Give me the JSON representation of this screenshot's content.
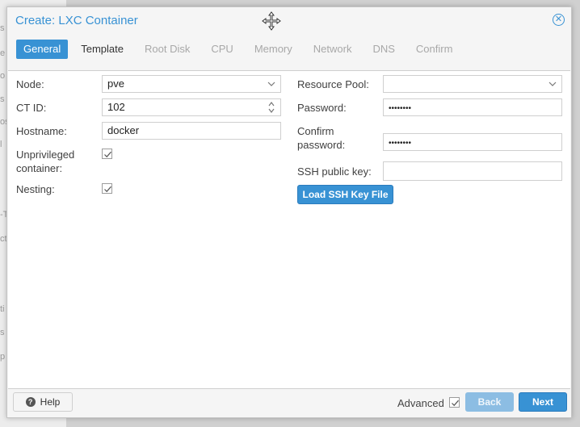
{
  "background": {
    "fragments": [
      "s",
      "e",
      "o",
      "s",
      "os",
      "l",
      "-T",
      "ct",
      "ti",
      "s",
      "p"
    ]
  },
  "dialog": {
    "title": "Create: LXC Container",
    "tabs": [
      {
        "label": "General",
        "state": "active"
      },
      {
        "label": "Template",
        "state": "enabled"
      },
      {
        "label": "Root Disk",
        "state": "disabled"
      },
      {
        "label": "CPU",
        "state": "disabled"
      },
      {
        "label": "Memory",
        "state": "disabled"
      },
      {
        "label": "Network",
        "state": "disabled"
      },
      {
        "label": "DNS",
        "state": "disabled"
      },
      {
        "label": "Confirm",
        "state": "disabled"
      }
    ],
    "accent_color": "#3892d4"
  },
  "form": {
    "node": {
      "label": "Node:",
      "value": "pve"
    },
    "ctid": {
      "label": "CT ID:",
      "value": "102"
    },
    "hostname": {
      "label": "Hostname:",
      "value": "docker"
    },
    "unprivileged": {
      "label_line1": "Unprivileged",
      "label_line2": "container:",
      "checked": true
    },
    "nesting": {
      "label": "Nesting:",
      "checked": true
    },
    "resource_pool": {
      "label": "Resource Pool:",
      "value": ""
    },
    "password": {
      "label": "Password:",
      "value": "••••••••"
    },
    "confirm_password": {
      "label_line1": "Confirm",
      "label_line2": "password:",
      "value": "••••••••"
    },
    "ssh_key": {
      "label": "SSH public key:",
      "value": ""
    },
    "load_ssh_button": "Load SSH Key File"
  },
  "footer": {
    "help_label": "Help",
    "advanced_label": "Advanced",
    "advanced_checked": true,
    "back_label": "Back",
    "next_label": "Next"
  }
}
